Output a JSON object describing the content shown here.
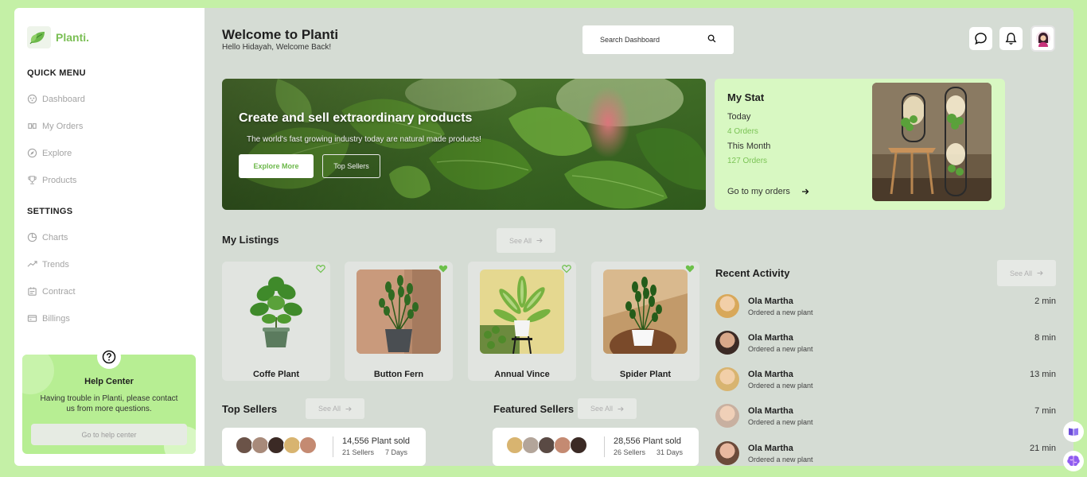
{
  "brand": {
    "name": "Planti."
  },
  "sidebar": {
    "quick_menu_title": "QUICK MENU",
    "quick_menu": [
      {
        "label": "Dashboard",
        "icon": "dashboard-icon"
      },
      {
        "label": "My Orders",
        "icon": "orders-icon"
      },
      {
        "label": "Explore",
        "icon": "explore-icon"
      },
      {
        "label": "Products",
        "icon": "trophy-icon"
      }
    ],
    "settings_title": "SETTINGS",
    "settings": [
      {
        "label": "Charts",
        "icon": "pie-chart-icon"
      },
      {
        "label": "Trends",
        "icon": "trend-icon"
      },
      {
        "label": "Contract",
        "icon": "contract-icon"
      },
      {
        "label": "Billings",
        "icon": "billing-icon"
      }
    ],
    "help": {
      "title": "Help Center",
      "text": "Having trouble in Planti, please contact us from more questions.",
      "button": "Go to help center"
    }
  },
  "header": {
    "title": "Welcome to Planti",
    "subtitle": "Hello Hidayah, Welcome Back!",
    "search_placeholder": "Search Dashboard"
  },
  "banner": {
    "title": "Create and sell extraordinary products",
    "subtitle": "The world's fast growing industry today are natural made products!",
    "primary_button": "Explore More",
    "secondary_button": "Top Sellers"
  },
  "stat": {
    "title": "My Stat",
    "today_label": "Today",
    "today_value": "4 Orders",
    "month_label": "This Month",
    "month_value": "127 Orders",
    "link": "Go to my orders"
  },
  "listings": {
    "title": "My Listings",
    "see_all": "See All",
    "items": [
      {
        "name": "Coffe Plant",
        "liked": false
      },
      {
        "name": "Button Fern",
        "liked": true
      },
      {
        "name": "Annual Vince",
        "liked": false
      },
      {
        "name": "Spider Plant",
        "liked": true
      }
    ]
  },
  "top_sellers": {
    "title": "Top Sellers",
    "see_all": "See All",
    "sold": "14,556 Plant sold",
    "sellers": "21 Sellers",
    "days": "7 Days"
  },
  "featured_sellers": {
    "title": "Featured Sellers",
    "see_all": "See All",
    "sold": "28,556 Plant sold",
    "sellers": "26 Sellers",
    "days": "31 Days"
  },
  "activity": {
    "title": "Recent Activity",
    "see_all": "See All",
    "items": [
      {
        "name": "Ola Martha",
        "desc": "Ordered a new plant",
        "time": "2 min"
      },
      {
        "name": "Ola Martha",
        "desc": "Ordered a new plant",
        "time": "8 min"
      },
      {
        "name": "Ola Martha",
        "desc": "Ordered a new plant",
        "time": "13 min"
      },
      {
        "name": "Ola Martha",
        "desc": "Ordered a new plant",
        "time": "7 min"
      },
      {
        "name": "Ola Martha",
        "desc": "Ordered a new plant",
        "time": "21 min"
      }
    ]
  },
  "colors": {
    "accent": "#7bc356",
    "background": "#c4f0a6",
    "main": "#d5dcd4",
    "help_card": "#b7ee93"
  }
}
